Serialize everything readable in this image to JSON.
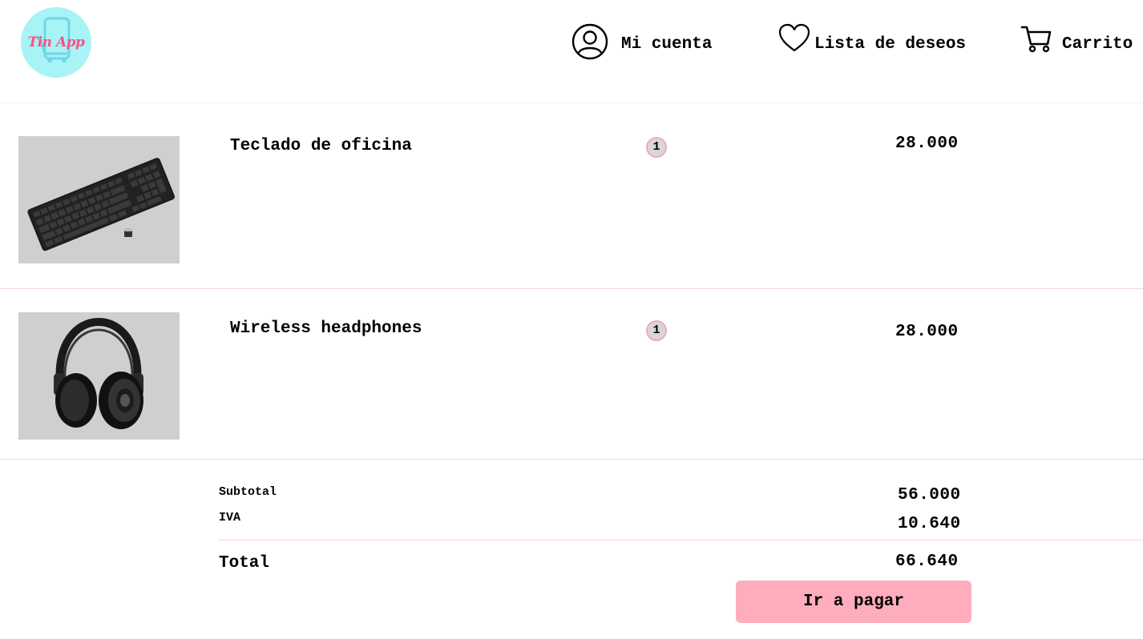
{
  "header": {
    "logo_text": "Tin App",
    "nav": {
      "account_label": "Mi cuenta",
      "wishlist_label": "Lista de deseos",
      "cart_label": "Carrito"
    },
    "icons": {
      "account": "user-circle-icon",
      "wishlist": "heart-icon",
      "cart": "shopping-cart-icon"
    }
  },
  "cart": {
    "items": [
      {
        "name": "Teclado de oficina",
        "quantity": "1",
        "price": "28.000",
        "image": "keyboard-image"
      },
      {
        "name": "Wireless headphones",
        "quantity": "1",
        "price": "28.000",
        "image": "headphones-image"
      }
    ]
  },
  "summary": {
    "subtotal_label": "Subtotal",
    "subtotal_value": "56.000",
    "iva_label": "IVA",
    "iva_value": "10.640",
    "total_label": "Total",
    "total_value": "66.640",
    "pay_button_label": "Ir a pagar"
  },
  "colors": {
    "logo_background": "#a8f3f6",
    "logo_text": "#ff4f86",
    "accent_button": "#ffadbc",
    "divider": "#f4d4dc",
    "thumbnail_background": "#cfcfcf"
  }
}
